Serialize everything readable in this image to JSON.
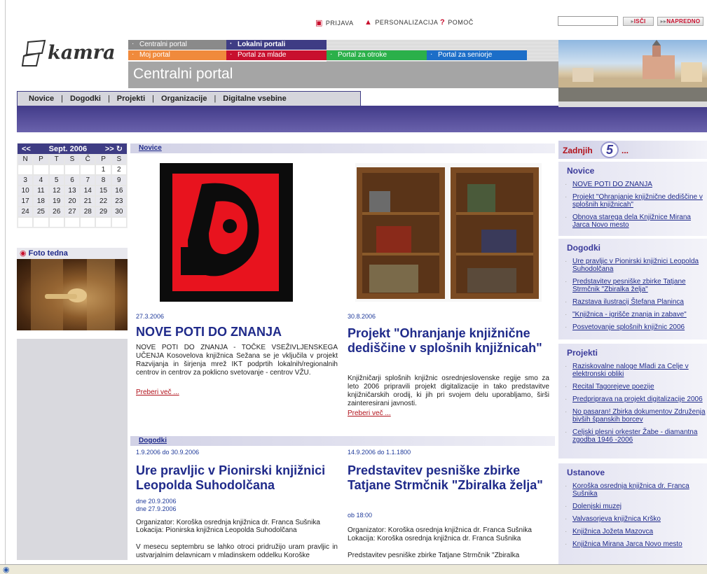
{
  "util": {
    "login": "PRIJAVA",
    "personal": "PERSONALIZACIJA",
    "help": "POMOČ",
    "search_btn": "ISČI",
    "advanced_btn": "NAPREDNO"
  },
  "logo": {
    "text": "kamra"
  },
  "portals": {
    "central": "Centralni portal",
    "local": "Lokalni portali",
    "mine": "Moj portal",
    "youth": "Portal za mlade",
    "kids": "Portal za otroke",
    "seniors": "Portal za seniorje"
  },
  "banner": {
    "title": "Centralni portal"
  },
  "nav": [
    "Novice",
    "Dogodki",
    "Projekti",
    "Organizacije",
    "Digitalne vsebine"
  ],
  "calendar": {
    "prev": "<<",
    "month": "Sept. 2006",
    "next": ">>",
    "days": [
      "N",
      "P",
      "T",
      "S",
      "Č",
      "P",
      "S"
    ],
    "weeks": [
      [
        "",
        "",
        "",
        "",
        "",
        "1",
        "2"
      ],
      [
        "3",
        "4",
        "5",
        "6",
        "7",
        "8",
        "9"
      ],
      [
        "10",
        "11",
        "12",
        "13",
        "14",
        "15",
        "16"
      ],
      [
        "17",
        "18",
        "19",
        "20",
        "21",
        "22",
        "23"
      ],
      [
        "24",
        "25",
        "26",
        "27",
        "28",
        "29",
        "30"
      ],
      [
        "",
        "",
        "",
        "",
        "",
        "",
        ""
      ]
    ]
  },
  "foto": {
    "title": "Foto tedna"
  },
  "news": {
    "section": "Novice",
    "items": [
      {
        "date": "27.3.2006",
        "title": "NOVE POTI DO ZNANJA",
        "body": "NOVE POTI DO ZNANJA - TOČKE VSEŽIVLJENSKEGA UČENJA Kosovelova knjižnica Sežana se je vključila v projekt Razvijanja in širjenja mrež IKT podprtih lokalnih/regionalnih centrov in centrov za poklicno svetovanje - centrov VŽU.",
        "more": "Preberi več ..."
      },
      {
        "date": "30.8.2006",
        "title": "Projekt \"Ohranjanje knjižnične dediščine v splošnih knjižnicah\"",
        "body": "Knjižničarji splošnih knjižnic osrednjeslovenske regije smo za leto 2006 pripravili projekt digitalizacije in tako predstavitve knjižničarskih orodij, ki jih pri svojem delu uporabljamo, širši zainteresirani javnosti.",
        "more": "Preberi več ..."
      }
    ]
  },
  "events": {
    "section": "Dogodki",
    "items": [
      {
        "range": "1.9.2006 do 30.9.2006",
        "title": "Ure pravljic v Pionirski knjižnici Leopolda Suhodolčana",
        "when1": "dne 20.9.2006",
        "when2": "dne 27.9.2006",
        "org": "Organizator: Koroška osrednja knjižnica dr. Franca Sušnika",
        "loc": "Lokacija: Pionirska knjižnica Leopolda Suhodolčana",
        "body": "V mesecu septembru se lahko otroci pridružijo uram pravljic in ustvarjalnim delavnicam v mladinskem oddelku Koroške"
      },
      {
        "range": "14.9.2006 do 1.1.1800",
        "title": "Predstavitev pesniške zbirke Tatjane Strmčnik \"Zbiralka želja\"",
        "when1": "ob 18:00",
        "org": "Organizator: Koroška osrednja knjižnica dr. Franca Sušnika",
        "loc": "Lokacija: Koroška osrednja knjižnica dr. Franca Sušnika",
        "body": "Predstavitev pesniške zbirke Tatjane Strmčnik \"Zbiralka"
      }
    ]
  },
  "latest": {
    "label": "Zadnjih",
    "count": "5",
    "ellipsis": "...",
    "groups": [
      {
        "title": "Novice",
        "items": [
          "NOVE POTI DO ZNANJA",
          "Projekt \"Ohranjanje knjižnične dediščine v splošnih knjižnicah\"",
          "Obnova starega dela Knjižnice Mirana Jarca Novo mesto"
        ]
      },
      {
        "title": "Dogodki",
        "items": [
          "Ure pravljic v Pionirski knjižnici Leopolda Suhodolčana",
          "Predstavitev pesniške zbirke Tatjane Strmčnik \"Zbiralka želja\"",
          "Razstava ilustracij Štefana Planinca",
          "\"Knjižnica - igrišče znanja in zabave\"",
          "Posvetovanje splošnih knjižnic 2006"
        ]
      },
      {
        "title": "Projekti",
        "items": [
          "Raziskovalne naloge Mladi za Celje v elektronski obliki",
          "Recital Tagorejeve poezije",
          "Predpriprava na projekt digitalizacije 2006",
          "No pasaran! Zbirka dokumentov Združenja bivših španskih borcev",
          "Celjski plesni orkester Žabe - diamantna zgodba 1946 -2006"
        ]
      },
      {
        "title": "Ustanove",
        "items": [
          "Koroška osrednja knjižnica dr. Franca Sušnika",
          "Dolenjski muzej",
          "Valvasorjeva knjižnica Krško",
          "Knjižnica Jožeta Mazovca",
          "Knjižnica Mirana Jarca Novo mesto"
        ]
      }
    ]
  }
}
